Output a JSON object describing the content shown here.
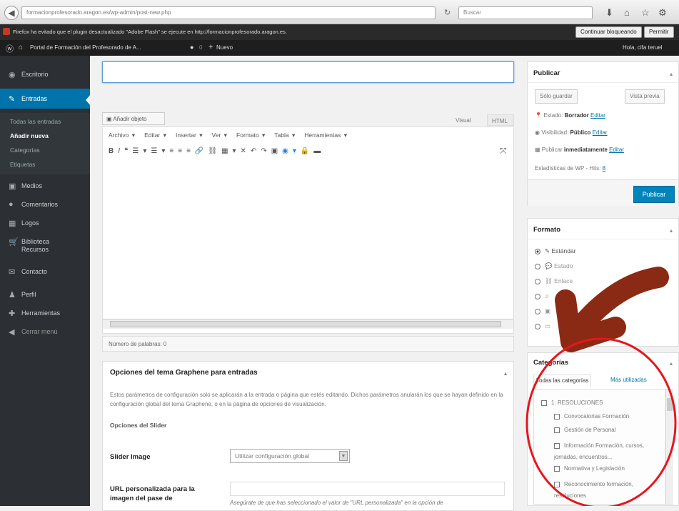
{
  "browser": {
    "url": "formacionprofesorado.aragon.es/wp-admin/post-new.php",
    "search_placeholder": "Buscar",
    "plugin_message": "Firefox ha evitado que el plugin desactualizado \"Adobe Flash\" se ejecute en http://formacionprofesorado.aragon.es.",
    "continue_blocking": "Continuar bloqueando",
    "allow": "Permitir"
  },
  "adminbar": {
    "site_name": "Portal de Formación del Profesorado de A...",
    "comments_count": "0",
    "new_label": "Nuevo",
    "greeting": "Hola, cifa teruel"
  },
  "sidebar": {
    "items": [
      {
        "label": "Escritorio",
        "icon": "dashboard-icon"
      },
      {
        "label": "Entradas",
        "icon": "pin-icon"
      },
      {
        "label": "Medios",
        "icon": "media-icon"
      },
      {
        "label": "Comentarios",
        "icon": "comments-icon"
      },
      {
        "label": "Logos",
        "icon": "grid-icon"
      },
      {
        "label": "Biblioteca Recursos",
        "icon": "cart-icon"
      },
      {
        "label": "Contacto",
        "icon": "mail-icon"
      },
      {
        "label": "Perfil",
        "icon": "user-icon"
      },
      {
        "label": "Herramientas",
        "icon": "wrench-icon"
      },
      {
        "label": "Cerrar menú",
        "icon": "collapse-icon"
      }
    ],
    "submenu": [
      "Todas las entradas",
      "Añadir nueva",
      "Categorías",
      "Etiquetas"
    ]
  },
  "editor": {
    "add_media": "Añadir objeto",
    "tab_visual": "Visual",
    "tab_html": "HTML",
    "menubar": [
      "Archivo",
      "Editar",
      "Insertar",
      "Ver",
      "Formato",
      "Tabla",
      "Herramientas"
    ],
    "word_count": "Número de palabras: 0"
  },
  "graphene": {
    "title": "Opciones del tema Graphene para entradas",
    "description": "Estos parámetros de configuración solo se aplicarán a la entrada o página que estés editando. Dichos parámetros anularán los que se hayan definido en la configuración global del tema Graphene, o en la página de opciones de visualización.",
    "slider_heading": "Opciones del Slider",
    "slider_image_label": "Slider Image",
    "slider_image_value": "Utilizar configuración global",
    "url_label": "URL personalizada para la imagen del pase de",
    "url_help": "Asegúrate de que has seleccionado el valor de \"URL personalizada\" en la opción de"
  },
  "publish": {
    "title": "Publicar",
    "save_draft": "Sólo guardar",
    "preview": "Vista previa",
    "status_label": "Estado:",
    "status_value": "Borrador",
    "visibility_label": "Visibilidad:",
    "visibility_value": "Público",
    "schedule_label": "Publicar",
    "schedule_value": "inmediatamente",
    "edit": "Editar",
    "stats": "Estadísticas de WP - Hits:",
    "publish_button": "Publicar"
  },
  "format": {
    "title": "Formato",
    "options": [
      {
        "label": "Estándar",
        "selected": true,
        "icon": "pin-icon"
      },
      {
        "label": "Estado",
        "selected": false,
        "icon": "chat-icon"
      },
      {
        "label": "Enlace",
        "selected": false,
        "icon": "link-icon"
      },
      {
        "label": "",
        "selected": false,
        "icon": "music-icon"
      },
      {
        "label": "",
        "selected": false,
        "icon": "image-icon"
      },
      {
        "label": "",
        "selected": false,
        "icon": "video-icon"
      }
    ]
  },
  "categories": {
    "title": "Categorías",
    "tab_all": "Todas las categorías",
    "tab_used": "Más utilizadas",
    "items": [
      {
        "label": "1. RESOLUCIONES",
        "level": 0
      },
      {
        "label": "Convocatorias Formación",
        "level": 1
      },
      {
        "label": "Gestión de Personal",
        "level": 1
      },
      {
        "label": "Información Formación, cursos, jornadas, encuentros...",
        "level": 1
      },
      {
        "label": "Normativa y Legislación",
        "level": 1
      },
      {
        "label": "Reconocimiento formación, resoluciones",
        "level": 1
      }
    ]
  },
  "colors": {
    "accent": "#0073aa",
    "annotation": "#8b2a14",
    "circle": "#e8141c"
  }
}
